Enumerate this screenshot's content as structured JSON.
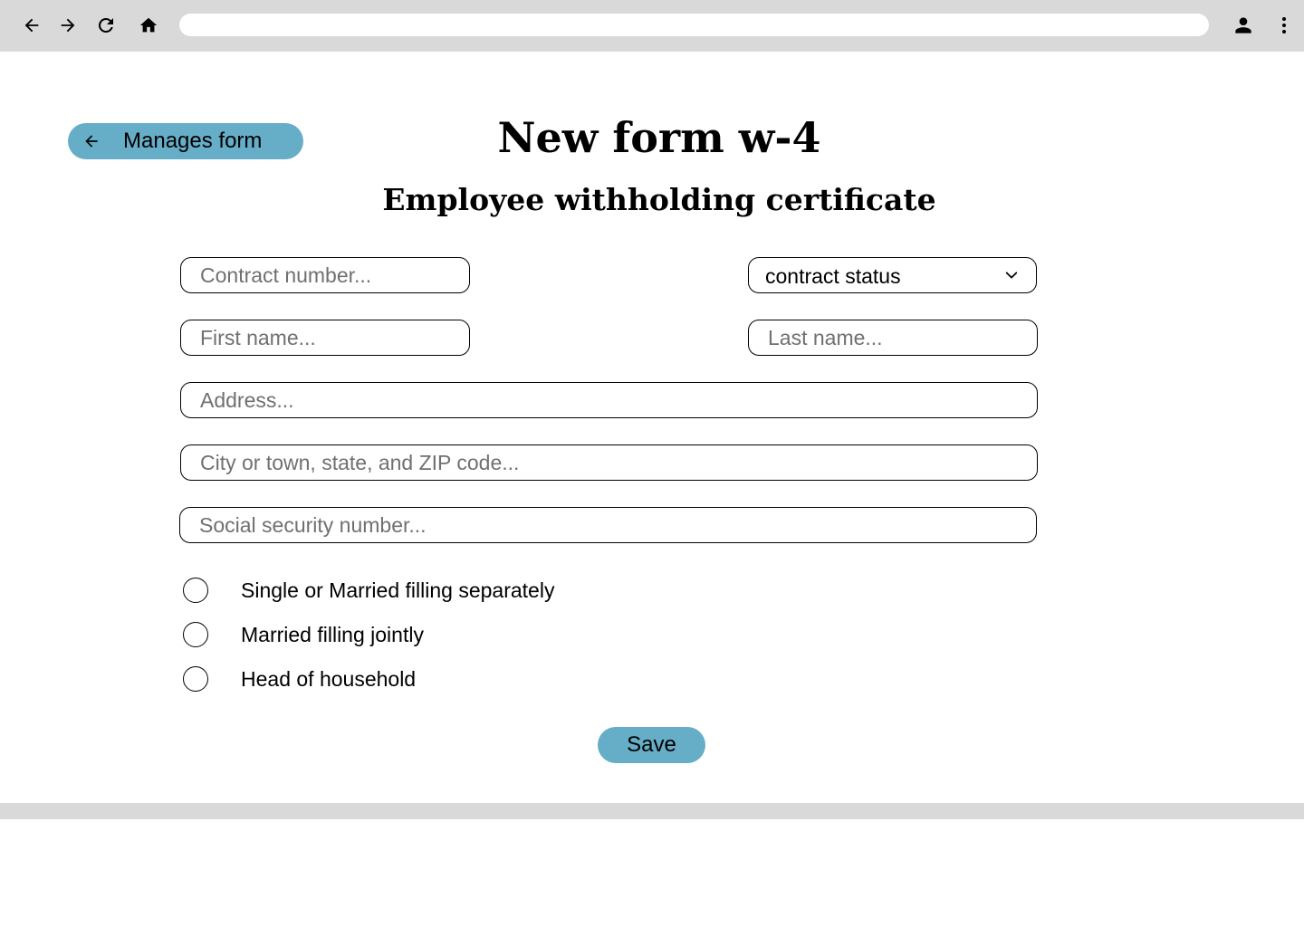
{
  "browser": {
    "address_value": "",
    "icons": [
      "back-arrow-icon",
      "forward-arrow-icon",
      "reload-icon",
      "home-icon",
      "account-icon",
      "more-vert-icon"
    ]
  },
  "back_button": {
    "label": "Manages form",
    "icon": "arrow-left-icon"
  },
  "header": {
    "title": "New form w-4",
    "subtitle": "Employee withholding certificate"
  },
  "form": {
    "contract_number_placeholder": "Contract number...",
    "contract_status_label": "contract status",
    "first_name_placeholder": "First name...",
    "last_name_placeholder": "Last name...",
    "address_placeholder": "Address...",
    "city_placeholder": "City or town, state, and ZIP code...",
    "ssn_placeholder": "Social security number...",
    "filing_status_options": [
      "Single or Married filling separately",
      "Married filling jointly",
      "Head of household"
    ],
    "save_label": "Save"
  },
  "colors": {
    "accent": "#66adc7",
    "chrome": "#d9d9d9"
  }
}
